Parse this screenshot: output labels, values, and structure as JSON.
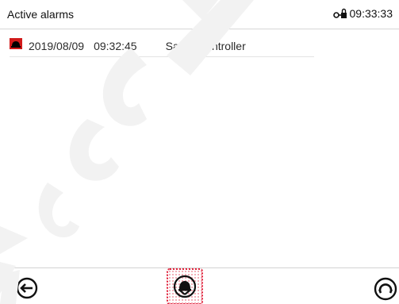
{
  "header": {
    "title": "Active alarms",
    "time": "09:33:33",
    "lock_icon": "key-lock-icon"
  },
  "alarms": [
    {
      "date": "2019/08/09",
      "time": "09:32:45",
      "message": "Safety controller",
      "icon": "alarm-bell-icon",
      "icon_color": "#d11a1a"
    }
  ],
  "footer": {
    "back_icon": "back-arrow-icon",
    "ack_icon": "acknowledge-alarm-icon",
    "reset_icon": "reset-icon"
  },
  "colors": {
    "alarm_red": "#d11a1a",
    "highlight": "#e0223b"
  }
}
